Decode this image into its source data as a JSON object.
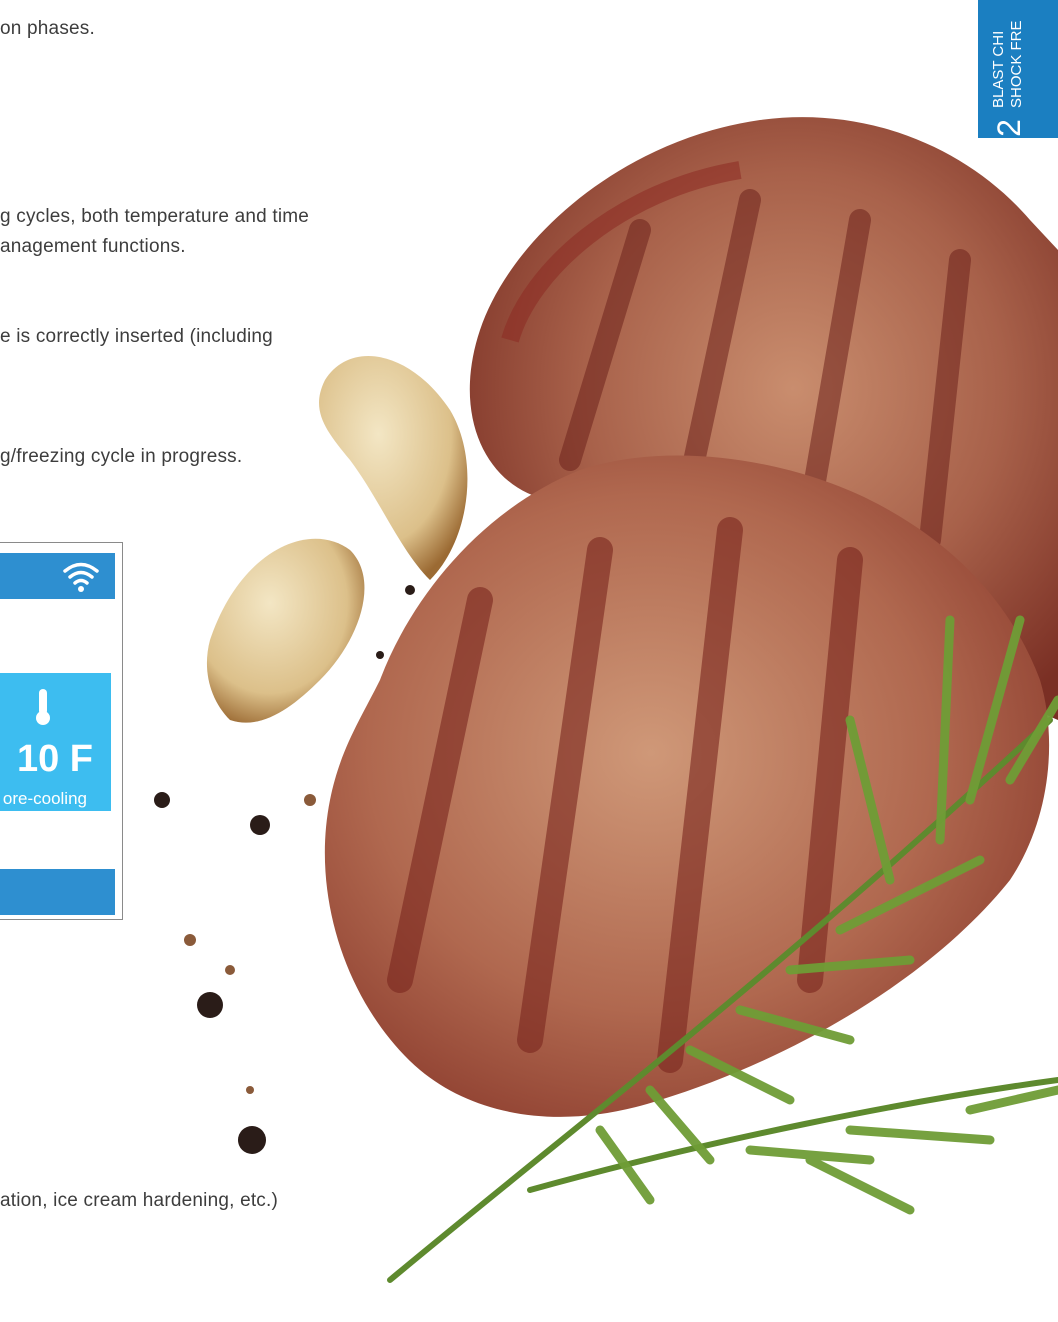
{
  "side_tab": {
    "number": "2",
    "line1": "BLAST CHI",
    "line2": "SHOCK FRE",
    "color": "#1b7fc1"
  },
  "paragraphs": [
    "on phases.",
    "g cycles, both temperature and time",
    "anagement functions.",
    "e is correctly inserted (including",
    "g/freezing cycle in progress.",
    "ation, ice cream hardening, etc.)"
  ],
  "device": {
    "temperature": "10 F",
    "mode": "ore-cooling",
    "icons": [
      "wifi-icon",
      "thermometer-icon"
    ],
    "colors": {
      "bar": "#2e8fd0",
      "tile": "#3dbdf0"
    }
  },
  "photo": {
    "subject": "grilled steaks with garlic, peppercorns and rosemary",
    "icons": [
      "steak-illustration"
    ]
  }
}
